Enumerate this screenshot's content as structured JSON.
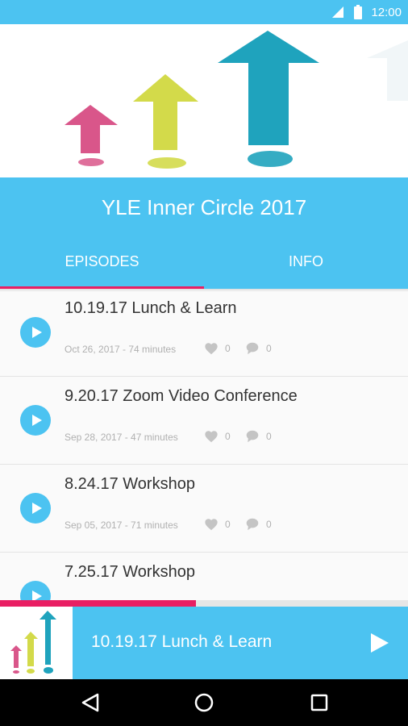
{
  "status_bar": {
    "time": "12:00",
    "icons": [
      "signal-icon",
      "battery-icon"
    ]
  },
  "podcast": {
    "title": "YLE Inner Circle 2017"
  },
  "tabs": [
    {
      "label": "EPISODES",
      "selected": true
    },
    {
      "label": "INFO",
      "selected": false
    }
  ],
  "episodes": [
    {
      "title": "10.19.17 Lunch & Learn",
      "meta": "Oct 26, 2017 - 74 minutes",
      "likes": "0",
      "comments": "0"
    },
    {
      "title": "9.20.17 Zoom Video Conference",
      "meta": "Sep 28, 2017 - 47 minutes",
      "likes": "0",
      "comments": "0"
    },
    {
      "title": "8.24.17 Workshop",
      "meta": "Sep 05, 2017 - 71 minutes",
      "likes": "0",
      "comments": "0"
    },
    {
      "title": "7.25.17 Workshop",
      "meta": "",
      "likes": "",
      "comments": ""
    }
  ],
  "player": {
    "title": "10.19.17 Lunch & Learn",
    "progress": 0.48
  },
  "colors": {
    "primary": "#4cc3f1",
    "accent": "#e91e63",
    "arrow_pink": "#d9568a",
    "arrow_yellow": "#d3da4a",
    "arrow_teal": "#1fa3bd"
  }
}
